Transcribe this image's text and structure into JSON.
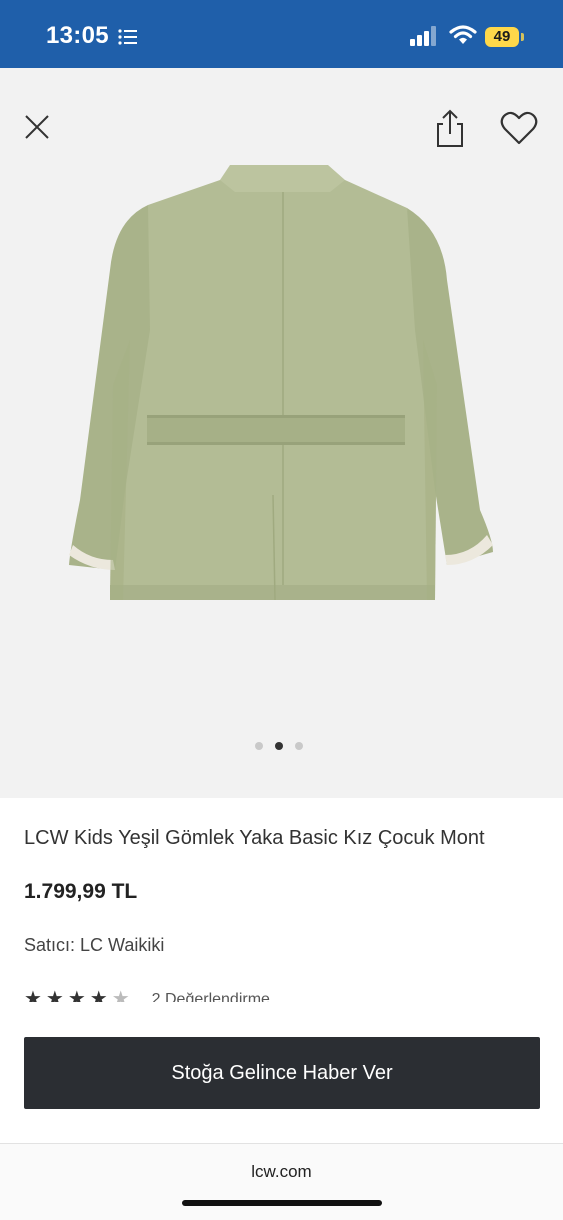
{
  "status_bar": {
    "time": "13:05",
    "battery": "49",
    "icons": [
      "list-icon",
      "signal-icon",
      "wifi-icon",
      "battery-icon"
    ],
    "color": "#1f5faa"
  },
  "gallery": {
    "icons": [
      "close-icon",
      "share-icon",
      "heart-icon"
    ],
    "image_subject": "jacket-back-view",
    "image_count": 3,
    "active_index": 1
  },
  "product": {
    "title": "LCW Kids Yeşil Gömlek Yaka Basic Kız Çocuk Mont",
    "price": "1.799,99 TL",
    "seller_label": "Satıcı:",
    "seller_name": "LC Waikiki",
    "rating": {
      "stars_filled": 4,
      "stars_total": 5,
      "stars_filled_text": "★★★★",
      "stars_empty_text": "★",
      "reviews": "2 Değerlendirme"
    }
  },
  "cta": {
    "notify_label": "Stoğa Gelince Haber Ver",
    "color": "#2b2e33"
  },
  "browser": {
    "url": "lcw.com"
  }
}
